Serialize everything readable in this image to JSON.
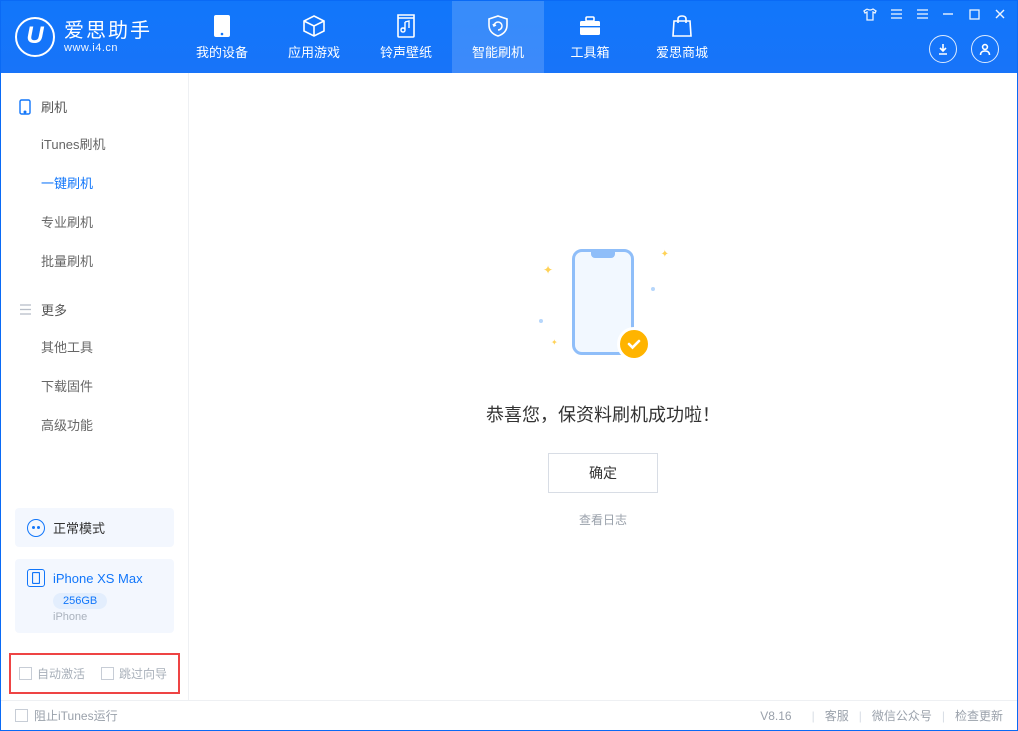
{
  "app": {
    "title": "爱思助手",
    "subtitle": "www.i4.cn"
  },
  "nav": {
    "items": [
      {
        "label": "我的设备"
      },
      {
        "label": "应用游戏"
      },
      {
        "label": "铃声壁纸"
      },
      {
        "label": "智能刷机"
      },
      {
        "label": "工具箱"
      },
      {
        "label": "爱思商城"
      }
    ]
  },
  "sidebar": {
    "section_flash": "刷机",
    "section_more": "更多",
    "items_flash": [
      {
        "label": "iTunes刷机"
      },
      {
        "label": "一键刷机"
      },
      {
        "label": "专业刷机"
      },
      {
        "label": "批量刷机"
      }
    ],
    "items_more": [
      {
        "label": "其他工具"
      },
      {
        "label": "下载固件"
      },
      {
        "label": "高级功能"
      }
    ],
    "mode_label": "正常模式",
    "device": {
      "name": "iPhone XS Max",
      "capacity": "256GB",
      "type": "iPhone"
    },
    "check_auto_activate": "自动激活",
    "check_skip_guide": "跳过向导"
  },
  "main": {
    "success_title": "恭喜您，保资料刷机成功啦！",
    "ok_button": "确定",
    "view_log": "查看日志"
  },
  "statusbar": {
    "block_itunes": "阻止iTunes运行",
    "version": "V8.16",
    "links": {
      "support": "客服",
      "wechat": "微信公众号",
      "update": "检查更新"
    }
  }
}
